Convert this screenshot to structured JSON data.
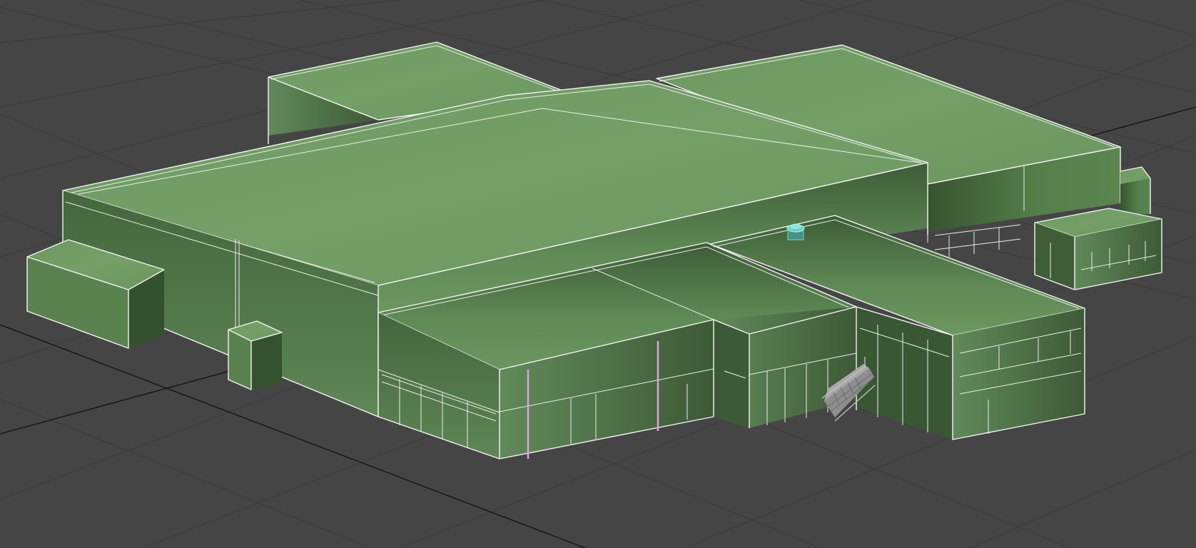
{
  "viewport": {
    "background_color": "#454545",
    "grid_color": "#3a3a3a",
    "grid_axis_color": "#111111",
    "roof_color": "#6f9a63",
    "wall_color_light": "#5d8652",
    "wall_color_dark": "#3f5d37",
    "wireframe_color": "#f4f4f4",
    "highlight_color": "#e0a0e0",
    "selected_object_color": "#5fc9c2",
    "stair_color": "#8e8e8e"
  },
  "scene_objects": [
    "ground-grid",
    "building-model",
    "rooftop-unit",
    "exterior-stair",
    "pink-guide-lines"
  ]
}
